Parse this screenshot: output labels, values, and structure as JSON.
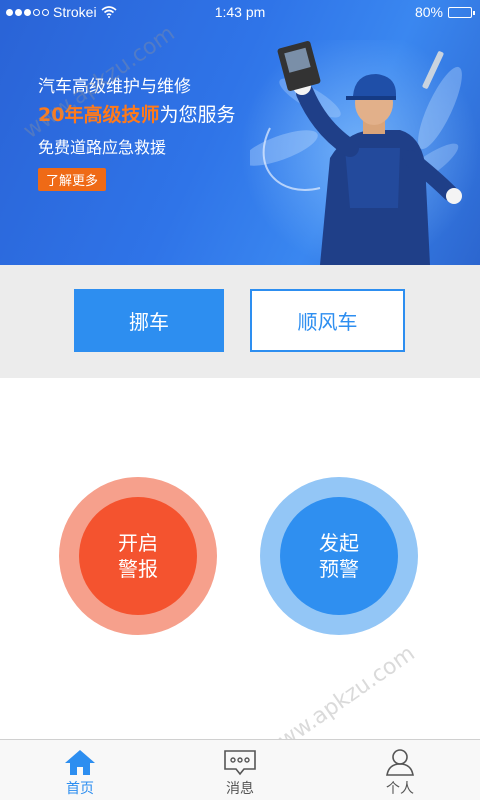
{
  "status_bar": {
    "carrier": "Strokei",
    "time": "1:43 pm",
    "battery": "80%",
    "battery_level": 0.8
  },
  "banner": {
    "line1": "汽车高级维护与维修",
    "line2_highlight": "20年高级技师",
    "line2_rest": "为您服务",
    "line3": "免费道路应急救援",
    "learn_more": "了解更多"
  },
  "actions": {
    "move_car": "挪车",
    "ride_share": "顺风车"
  },
  "circles": {
    "alarm_line1": "开启",
    "alarm_line2": "警报",
    "warn_line1": "发起",
    "warn_line2": "预警"
  },
  "tabs": [
    {
      "label": "首页",
      "icon": "home-icon",
      "active": true
    },
    {
      "label": "消息",
      "icon": "message-icon",
      "active": false
    },
    {
      "label": "个人",
      "icon": "person-icon",
      "active": false
    }
  ],
  "colors": {
    "primary": "#2d8ef0",
    "alarm": "#f4532f",
    "highlight": "#ff7a1a"
  },
  "watermark": "www.apkzu.com"
}
